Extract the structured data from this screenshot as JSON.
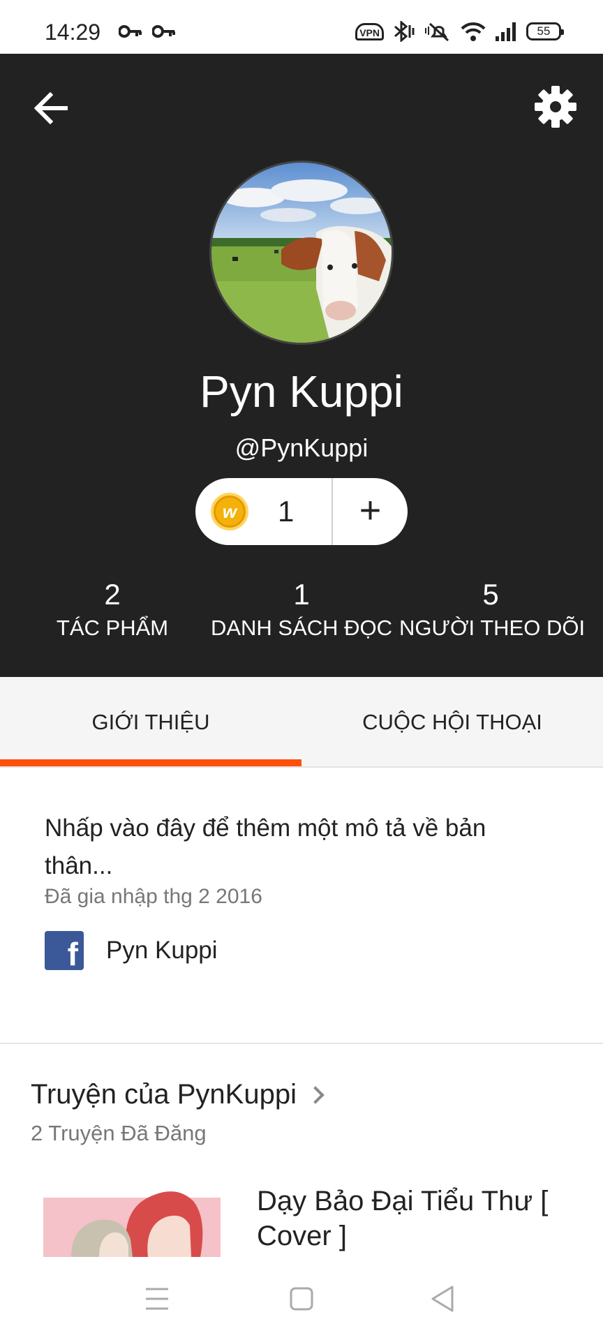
{
  "status_bar": {
    "time": "14:29",
    "vpn_label": "VPN",
    "battery": "55",
    "icons": [
      "key-icon",
      "key-icon",
      "vpn-icon",
      "bluetooth-icon",
      "mute-icon",
      "wifi-icon",
      "signal-icon",
      "battery-icon"
    ]
  },
  "header": {
    "back_icon": "arrow-left-icon",
    "settings_icon": "gear-icon",
    "display_name": "Pyn Kuppi",
    "username": "@PynKuppi",
    "coins": {
      "icon_letter": "w",
      "count": "1",
      "add_label": "+"
    },
    "stats": [
      {
        "value": "2",
        "label": "TÁC PHẨM"
      },
      {
        "value": "1",
        "label": "DANH SÁCH ĐỌC"
      },
      {
        "value": "5",
        "label": "NGƯỜI THEO DÕI"
      }
    ]
  },
  "tabs": [
    {
      "label": "GIỚI THIỆU",
      "active": true
    },
    {
      "label": "CUỘC HỘI THOẠI",
      "active": false
    }
  ],
  "about": {
    "description": "Nhấp vào đây để thêm một mô tả về bản thân...",
    "joined": "Đã gia nhập thg 2 2016",
    "facebook_icon_letter": "f",
    "facebook_name": "Pyn Kuppi"
  },
  "stories": {
    "title": "Truyện của PynKuppi",
    "count": "2 Truyện Đã Đăng",
    "items": [
      {
        "title": "Dạy Bảo Đại Tiểu Thư [ Cover ]"
      }
    ]
  },
  "nav_bar": {
    "icons": [
      "menu-icon",
      "home-square-icon",
      "back-triangle-icon"
    ]
  },
  "colors": {
    "header_bg": "#222222",
    "accent": "#ff500a",
    "facebook": "#3b5998",
    "coin": "#f4b10b"
  }
}
